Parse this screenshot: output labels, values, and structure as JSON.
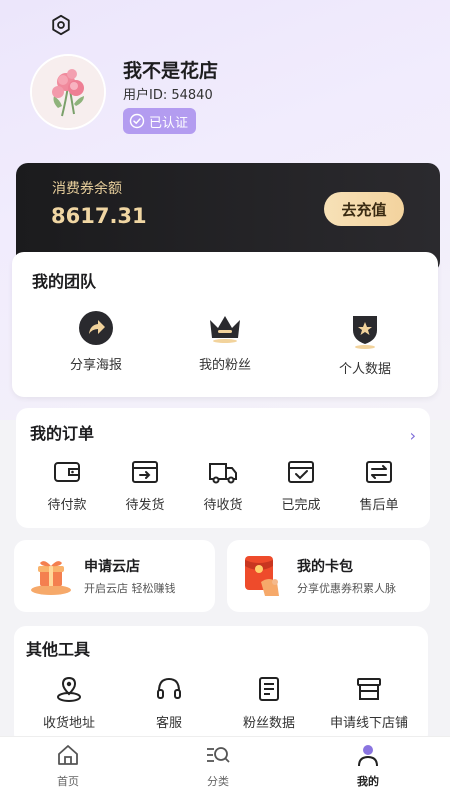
{
  "profile": {
    "username": "我不是花店",
    "user_id": "用户ID: 54840",
    "verified_label": "已认证"
  },
  "voucher": {
    "label": "消费券余额",
    "amount": "8617.31",
    "recharge_label": "去充值"
  },
  "team": {
    "title": "我的团队",
    "items": [
      {
        "label": "分享海报",
        "icon": "share-icon"
      },
      {
        "label": "我的粉丝",
        "icon": "crown-icon"
      },
      {
        "label": "个人数据",
        "icon": "badge-icon"
      }
    ]
  },
  "orders": {
    "title": "我的订单",
    "items": [
      {
        "label": "待付款",
        "icon": "wallet-icon"
      },
      {
        "label": "待发货",
        "icon": "ship-box-icon"
      },
      {
        "label": "待收货",
        "icon": "truck-icon"
      },
      {
        "label": "已完成",
        "icon": "done-box-icon"
      },
      {
        "label": "售后单",
        "icon": "exchange-icon"
      }
    ]
  },
  "promos": [
    {
      "title": "申请云店",
      "subtitle": "开启云店 轻松赚钱",
      "icon": "gift-icon"
    },
    {
      "title": "我的卡包",
      "subtitle": "分享优惠券积累人脉",
      "icon": "red-envelope-icon"
    }
  ],
  "tools": {
    "title": "其他工具",
    "items": [
      {
        "label": "收货地址",
        "icon": "location-icon"
      },
      {
        "label": "客服",
        "icon": "headset-icon"
      },
      {
        "label": "粉丝数据",
        "icon": "document-icon"
      },
      {
        "label": "申请线下店铺",
        "icon": "store-icon"
      }
    ]
  },
  "tabbar": {
    "items": [
      {
        "label": "首页",
        "icon": "home-icon"
      },
      {
        "label": "分类",
        "icon": "category-search-icon"
      },
      {
        "label": "我的",
        "icon": "user-icon",
        "active": true
      }
    ]
  },
  "colors": {
    "accent": "#b39cf0",
    "gold": "#f0d6a3",
    "dark_card": "#1b1b1d"
  }
}
